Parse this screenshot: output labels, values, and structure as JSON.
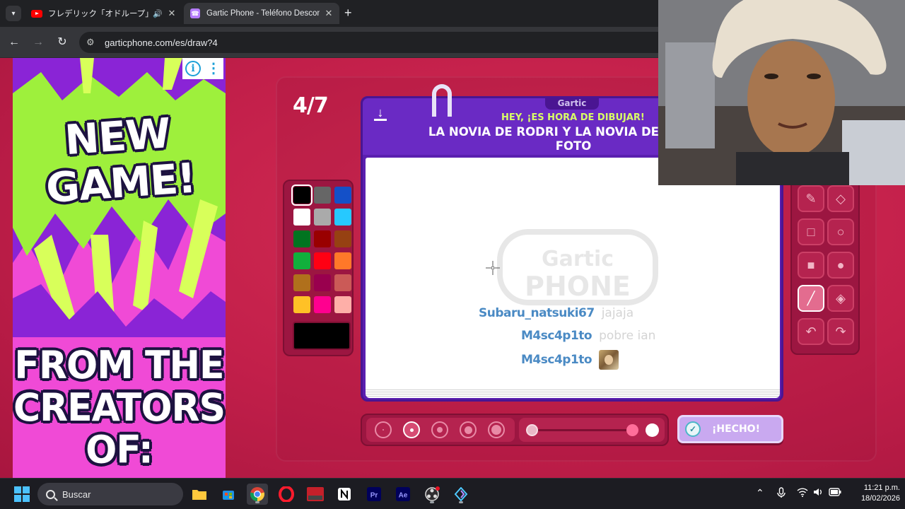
{
  "browser": {
    "tabs": [
      {
        "title": "フレデリック「オドループ」Music V",
        "favicon": "youtube-icon",
        "audio": true
      },
      {
        "title": "Gartic Phone - Teléfono Descon",
        "favicon": "gartic-icon",
        "active": true
      }
    ],
    "url": "garticphone.com/es/draw?4"
  },
  "ad": {
    "headline": "NEW GAME!",
    "subheadline": "FROM THE CREATORS OF:",
    "colors": {
      "green": "#9ef03c",
      "purple": "#8a24d6",
      "pink": "#f04ad6"
    }
  },
  "game": {
    "round": "4/7",
    "brand": "Gartic",
    "watermark_top": "Gartic",
    "watermark_bottom": "PHONE",
    "prompt_hint": "HEY, ¡ES HORA DE DIBUJAR!",
    "prompt_line1": "LA NOVIA DE RODRI Y LA NOVIA DE ITSEVEN",
    "prompt_line2": "FOTO",
    "chat": [
      {
        "user": "Subaru_natsuki67",
        "message": "jajaja"
      },
      {
        "user": "M4sc4p1to",
        "message": "pobre ian"
      },
      {
        "user": "M4sc4p1to",
        "message": "",
        "sticker": "photo-sticker"
      }
    ],
    "palette": [
      "#000000",
      "#666666",
      "#1450c8",
      "#ffffff",
      "#aaaaaa",
      "#26c9ff",
      "#017420",
      "#990000",
      "#964112",
      "#11b03c",
      "#ff0013",
      "#ff7829",
      "#b0701c",
      "#99004e",
      "#cb5a57",
      "#ffc126",
      "#ff008f",
      "#feafa8"
    ],
    "selected_color": "#000000",
    "tools": [
      {
        "name": "pencil-icon",
        "glyph": "✎"
      },
      {
        "name": "eraser-icon",
        "glyph": "◇"
      },
      {
        "name": "rectangle-outline-icon",
        "glyph": "□"
      },
      {
        "name": "circle-outline-icon",
        "glyph": "○"
      },
      {
        "name": "rectangle-filled-icon",
        "glyph": "■"
      },
      {
        "name": "circle-filled-icon",
        "glyph": "●"
      },
      {
        "name": "line-icon",
        "glyph": "╱",
        "active": true
      },
      {
        "name": "fill-bucket-icon",
        "glyph": "◈"
      },
      {
        "name": "undo-icon",
        "glyph": "↶"
      },
      {
        "name": "redo-icon",
        "glyph": "↷"
      }
    ],
    "brush_sizes": 5,
    "selected_brush_size": 2,
    "opacity_level": 1.0,
    "done_label": "¡HECHO!"
  },
  "taskbar": {
    "search_placeholder": "Buscar",
    "apps": [
      "file-explorer-icon",
      "store-icon",
      "chrome-icon",
      "opera-icon",
      "voicemeeter-icon",
      "notion-icon",
      "premiere-icon",
      "after-effects-icon",
      "obs-icon",
      "app-icon"
    ],
    "time": "11:21 p.m.",
    "date": "18/02/2026"
  }
}
